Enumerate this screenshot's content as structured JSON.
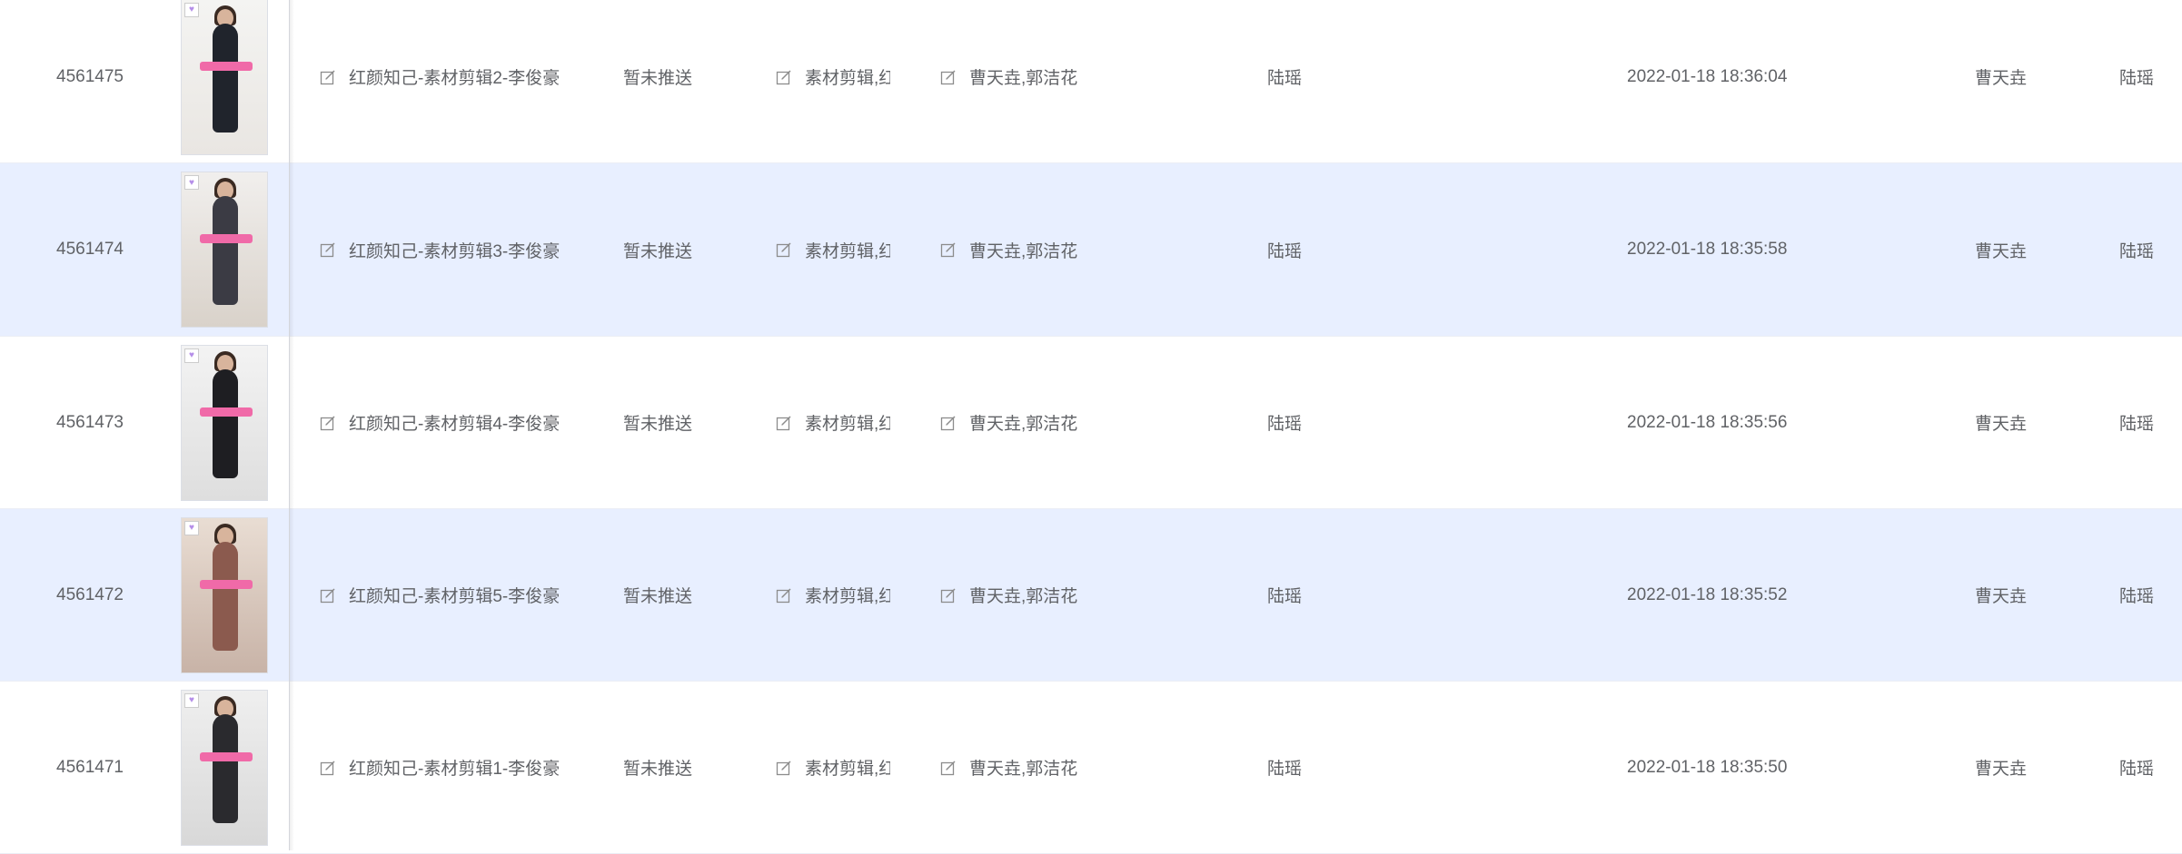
{
  "colors": {
    "stripe_bg": "#e8efff",
    "text": "#606266",
    "border": "#ebeef5",
    "icon": "#8c8c8c"
  },
  "rows": [
    {
      "id": "4561475",
      "title": "红颜知己-素材剪辑2-李俊豪",
      "push": "暂未推送",
      "tags": "素材剪辑,红颜知己",
      "owners": "曹天垚,郭洁花",
      "editor": "陆瑶",
      "time": "2022-01-18 18:36:04",
      "creator": "曹天垚",
      "last": "陆瑶",
      "thumb_icon": "heart-icon"
    },
    {
      "id": "4561474",
      "title": "红颜知己-素材剪辑3-李俊豪",
      "push": "暂未推送",
      "tags": "素材剪辑,红颜知己",
      "owners": "曹天垚,郭洁花",
      "editor": "陆瑶",
      "time": "2022-01-18 18:35:58",
      "creator": "曹天垚",
      "last": "陆瑶",
      "thumb_icon": "heart-icon"
    },
    {
      "id": "4561473",
      "title": "红颜知己-素材剪辑4-李俊豪",
      "push": "暂未推送",
      "tags": "素材剪辑,红颜知己",
      "owners": "曹天垚,郭洁花",
      "editor": "陆瑶",
      "time": "2022-01-18 18:35:56",
      "creator": "曹天垚",
      "last": "陆瑶",
      "thumb_icon": "heart-icon"
    },
    {
      "id": "4561472",
      "title": "红颜知己-素材剪辑5-李俊豪",
      "push": "暂未推送",
      "tags": "素材剪辑,红颜知己",
      "owners": "曹天垚,郭洁花",
      "editor": "陆瑶",
      "time": "2022-01-18 18:35:52",
      "creator": "曹天垚",
      "last": "陆瑶",
      "thumb_icon": "heart-icon"
    },
    {
      "id": "4561471",
      "title": "红颜知己-素材剪辑1-李俊豪",
      "push": "暂未推送",
      "tags": "素材剪辑,红颜知己",
      "owners": "曹天垚,郭洁花",
      "editor": "陆瑶",
      "time": "2022-01-18 18:35:50",
      "creator": "曹天垚",
      "last": "陆瑶",
      "thumb_icon": "heart-icon"
    }
  ]
}
